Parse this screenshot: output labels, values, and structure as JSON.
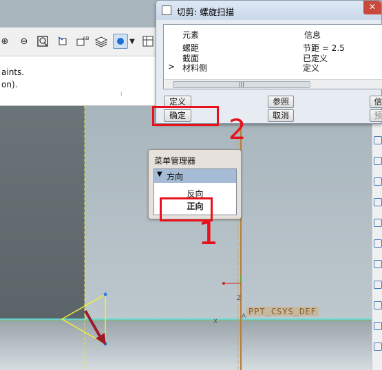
{
  "message_area": {
    "line1": "aints.",
    "line2": "on)."
  },
  "dialog": {
    "title": "切剪: 螺旋扫描",
    "columns": [
      "元素",
      "信息"
    ],
    "rows": [
      {
        "element": "螺距",
        "info": "节距 = 2.5"
      },
      {
        "element": "截面",
        "info": "已定义"
      },
      {
        "element": "材料侧",
        "info": "定义",
        "marker": ">"
      }
    ],
    "buttons": {
      "define": "定义",
      "refs": "参照",
      "info": "信",
      "ok": "确定",
      "cancel": "取消",
      "preview": "预"
    },
    "scroll_grip": "|||"
  },
  "menu_manager": {
    "title": "菜单管理器",
    "section": "方向",
    "items": [
      "反向",
      "正向"
    ],
    "selected_index": 1
  },
  "annotations": {
    "step1": "1",
    "step2": "2",
    "color": "#e8101c"
  },
  "viewport": {
    "csys_label": "PPT_CSYS_DEF",
    "axis_x": "X",
    "axis_z": "Z",
    "axis_a": "A"
  }
}
